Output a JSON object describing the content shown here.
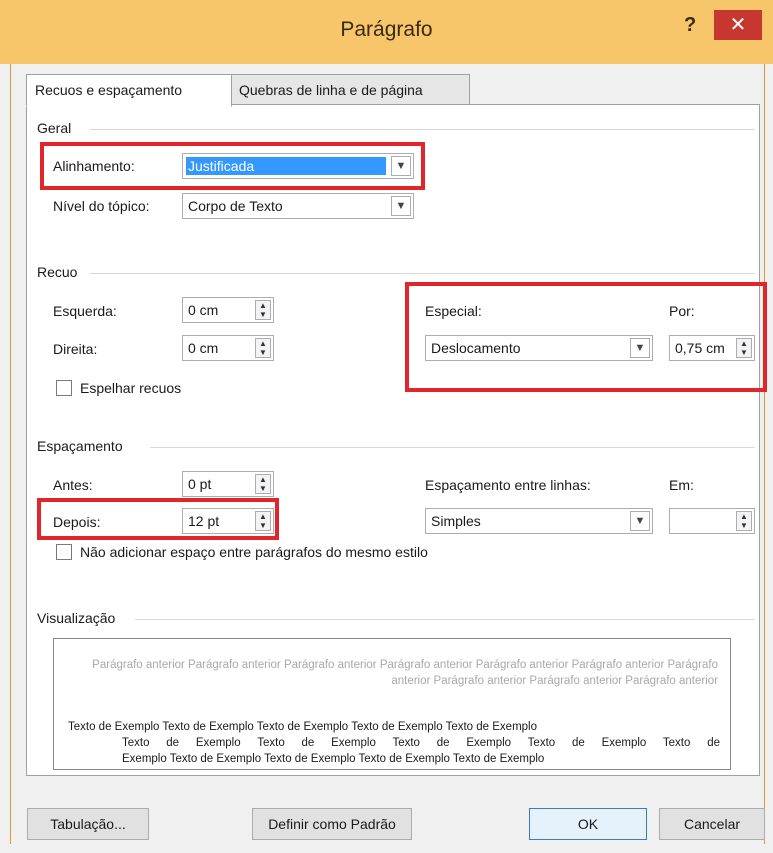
{
  "window": {
    "title": "Parágrafo",
    "help_label": "?",
    "close_label": "✕"
  },
  "tabs": [
    {
      "label": "Recuos e espaçamento",
      "active": true
    },
    {
      "label": "Quebras de linha e de página",
      "active": false
    }
  ],
  "geral": {
    "section_label": "Geral",
    "alignment_label": "Alinhamento:",
    "alignment_value": "Justificada",
    "outline_label": "Nível do tópico:",
    "outline_value": "Corpo de Texto"
  },
  "recuo": {
    "section_label": "Recuo",
    "left_label": "Esquerda:",
    "left_value": "0 cm",
    "right_label": "Direita:",
    "right_value": "0 cm",
    "mirror_label": "Espelhar recuos",
    "mirror_checked": false,
    "special_label": "Especial:",
    "special_value": "Deslocamento",
    "by_label": "Por:",
    "by_value": "0,75 cm"
  },
  "espacamento": {
    "section_label": "Espaçamento",
    "before_label": "Antes:",
    "before_value": "0 pt",
    "after_label": "Depois:",
    "after_value": "12 pt",
    "line_spacing_label": "Espaçamento entre linhas:",
    "line_spacing_value": "Simples",
    "at_label": "Em:",
    "at_value": "",
    "no_space_label": "Não adicionar espaço entre parágrafos do mesmo estilo",
    "no_space_checked": false
  },
  "preview": {
    "section_label": "Visualização",
    "previous_text": "Parágrafo anterior Parágrafo anterior Parágrafo anterior Parágrafo anterior Parágrafo anterior Parágrafo anterior Parágrafo anterior Parágrafo anterior Parágrafo anterior Parágrafo anterior",
    "sample_line1": "Texto de Exemplo Texto de Exemplo Texto de Exemplo Texto de Exemplo Texto de Exemplo",
    "sample_line2": "Texto de Exemplo Texto de Exemplo Texto de Exemplo Texto de Exemplo Texto de",
    "sample_line3": "Exemplo Texto de Exemplo Texto de Exemplo Texto de Exemplo Texto de Exemplo"
  },
  "buttons": {
    "tabs_label": "Tabulação...",
    "default_label": "Definir como Padrão",
    "ok_label": "OK",
    "cancel_label": "Cancelar"
  },
  "colors": {
    "titlebar": "#f7c56a",
    "close": "#c7372f",
    "highlight": "#e0252b",
    "selection": "#3399ff"
  }
}
